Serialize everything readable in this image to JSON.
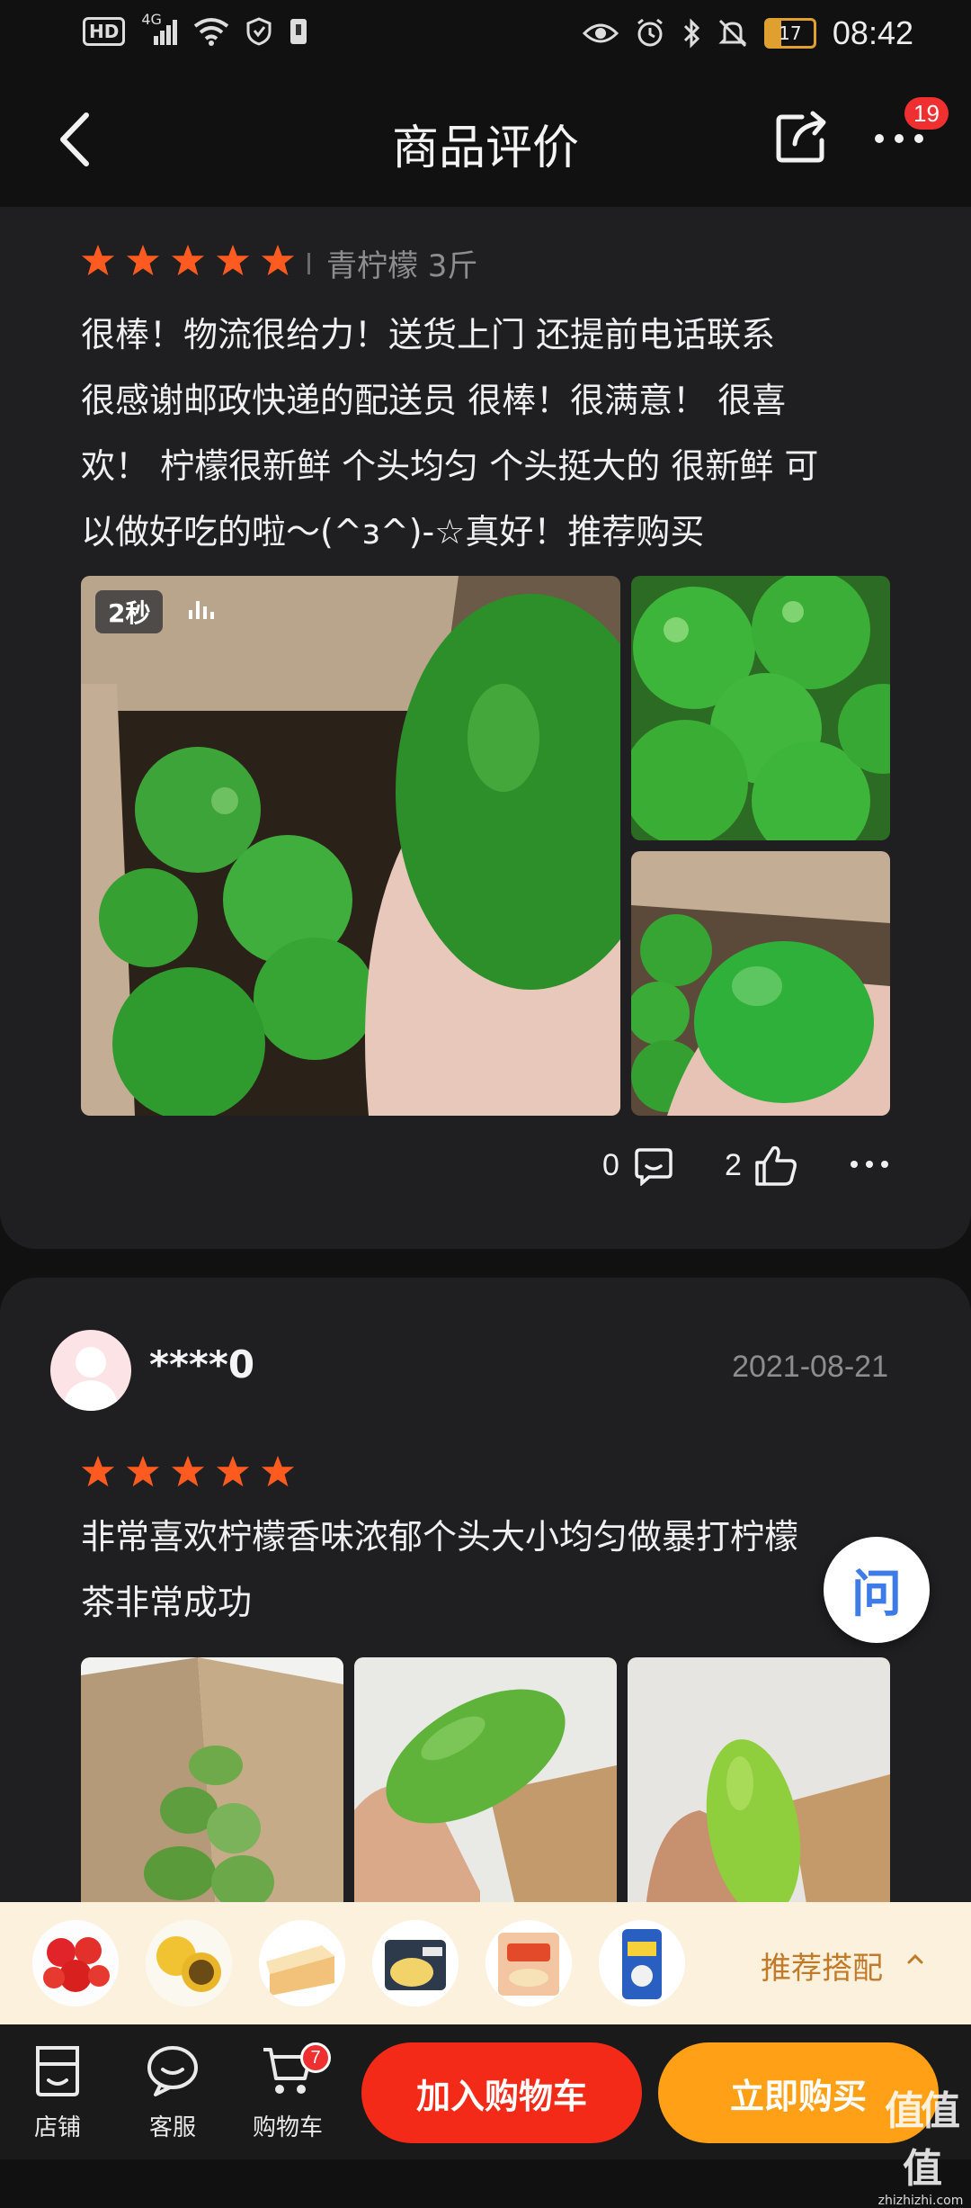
{
  "status_bar": {
    "hd_label": "HD",
    "network_label": "4G",
    "battery": "17",
    "time": "08:42"
  },
  "nav": {
    "title": "商品评价",
    "more_badge": "19"
  },
  "review1": {
    "rating": 5,
    "spec": "青柠檬 3斤",
    "lines": [
      "很棒！物流很给力！送货上门 还提前电话联系",
      "很感谢邮政快递的配送员 很棒！很满意！ 很喜",
      "欢！ 柠檬很新鲜 个头均匀 个头挺大的 很新鲜 可",
      "以做好吃的啦～(^з^)-☆真好！推荐购买"
    ],
    "video_duration": "2秒",
    "comment_count": "0",
    "like_count": "2"
  },
  "review2": {
    "username": "****0",
    "date": "2021-08-21",
    "rating": 5,
    "lines": [
      "非常喜欢柠檬香味浓郁个头大小均匀做暴打柠檬",
      "茶非常成功"
    ]
  },
  "ask_button": {
    "label": "问"
  },
  "recommend": {
    "label": "推荐搭配",
    "items": [
      "tomato-product",
      "passion-fruit-product",
      "cake-product",
      "durian-product",
      "biscuit-product",
      "drink-product"
    ]
  },
  "bottom_bar": {
    "shop_label": "店铺",
    "service_label": "客服",
    "cart_label": "购物车",
    "cart_badge": "7",
    "add_to_cart_label": "加入购物车",
    "buy_now_label": "立即购买"
  },
  "watermark": {
    "text": "值值值",
    "sub": "zhizhizhi.com"
  },
  "colors": {
    "star": "#ff5a1f",
    "accent_red": "#f42a18",
    "accent_orange": "#ffa016",
    "card_bg": "#1f1e20"
  }
}
